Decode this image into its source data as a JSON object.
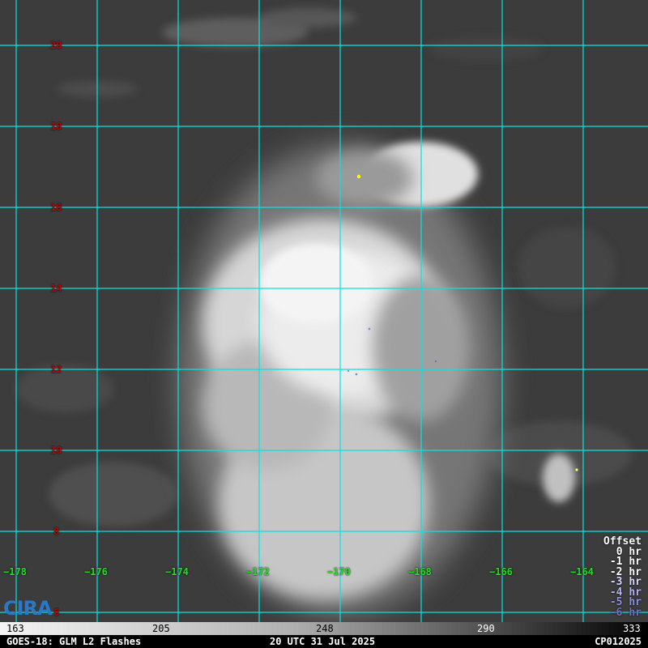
{
  "map": {
    "lat_labels": [
      "20",
      "18",
      "16",
      "14",
      "12",
      "10",
      "8",
      "6"
    ],
    "lon_labels": [
      "−178",
      "−176",
      "−174",
      "−172",
      "−170",
      "−168",
      "−166",
      "−164"
    ],
    "grid_color": "#00e5e5",
    "lat_label_color": "#c00000",
    "lon_label_color": "#22dd22",
    "glm_flash_color": "#ffff00"
  },
  "offset_legend": {
    "title": "Offset",
    "items": [
      {
        "label": "0 hr",
        "color": "#ffffff"
      },
      {
        "label": "-1 hr",
        "color": "#ffffff"
      },
      {
        "label": "-2 hr",
        "color": "#ffffff"
      },
      {
        "label": "-3 hr",
        "color": "#d8d8ff"
      },
      {
        "label": "-4 hr",
        "color": "#b4b4f0"
      },
      {
        "label": "-5 hr",
        "color": "#9090e0"
      },
      {
        "label": "-6 hr",
        "color": "#7070c8"
      }
    ]
  },
  "colorbar": {
    "ticks": [
      "163",
      "205",
      "248",
      "290",
      "333"
    ]
  },
  "footer": {
    "left": "GOES-18: GLM L2 Flashes",
    "center": "20 UTC 31 Jul 2025",
    "right": "CP012025"
  },
  "logo": {
    "text": "CIRA"
  }
}
